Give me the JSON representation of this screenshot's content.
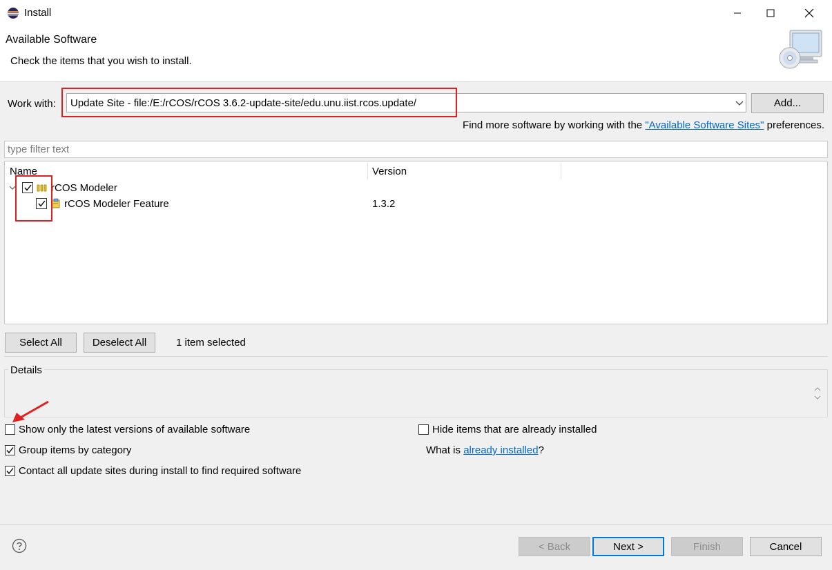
{
  "window": {
    "title": "Install"
  },
  "header": {
    "title": "Available Software",
    "description": "Check the items that you wish to install."
  },
  "work_with": {
    "label": "Work with:",
    "value": "Update Site - file:/E:/rCOS/rCOS 3.6.2-update-site/edu.unu.iist.rcos.update/",
    "add_label": "Add...",
    "find_more_prefix": "Find more software by working with the ",
    "find_more_link": "\"Available Software Sites\"",
    "find_more_suffix": " preferences."
  },
  "filter": {
    "placeholder": "type filter text"
  },
  "tree": {
    "columns": {
      "name": "Name",
      "version": "Version"
    },
    "items": [
      {
        "name": "rCOS Modeler",
        "version": "",
        "checked": true,
        "icon": "category-icon"
      },
      {
        "name": "rCOS Modeler Feature",
        "version": "1.3.2",
        "checked": true,
        "icon": "feature-icon"
      }
    ]
  },
  "selection": {
    "select_all": "Select All",
    "deselect_all": "Deselect All",
    "status": "1 item selected"
  },
  "details": {
    "label": "Details"
  },
  "options": {
    "latest_only": {
      "label": "Show only the latest versions of available software",
      "checked": false
    },
    "group_by_category": {
      "label": "Group items by category",
      "checked": true
    },
    "contact_sites": {
      "label": "Contact all update sites during install to find required software",
      "checked": true
    },
    "hide_installed": {
      "label": "Hide items that are already installed",
      "checked": false
    },
    "what_is_prefix": "What is ",
    "what_is_link": "already installed",
    "what_is_suffix": "?"
  },
  "footer": {
    "back": "< Back",
    "next": "Next >",
    "finish": "Finish",
    "cancel": "Cancel"
  },
  "colors": {
    "annotation": "#e02020",
    "link": "#0066cc",
    "focus": "#0078d7"
  }
}
